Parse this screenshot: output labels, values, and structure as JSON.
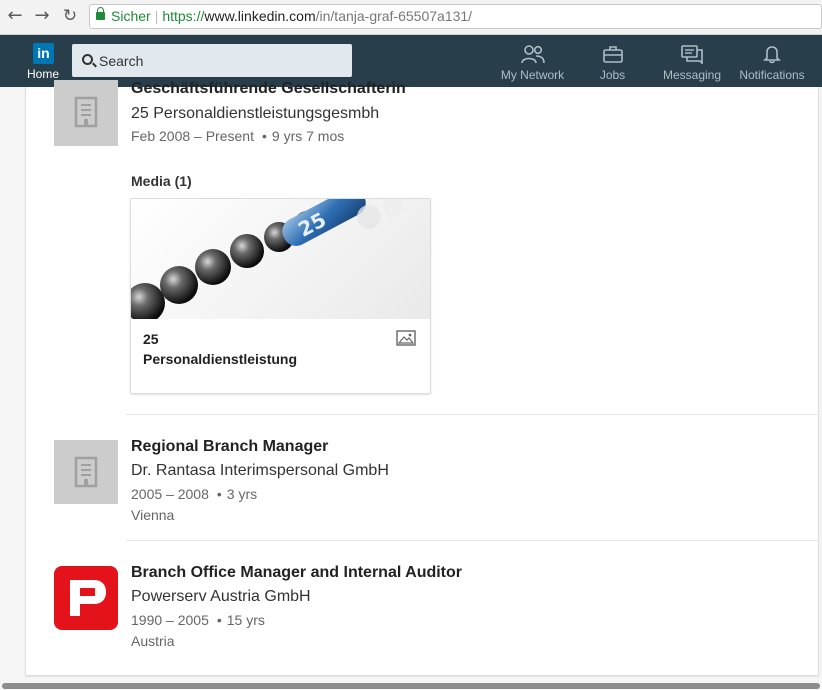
{
  "browser": {
    "secure_label": "Sicher",
    "url_scheme": "https://",
    "url_host": "www.linkedin.com",
    "url_path": "/in/tanja-graf-65507a131/"
  },
  "nav": {
    "logo_text": "in",
    "home_label": "Home",
    "search_placeholder": "Search",
    "items": [
      {
        "label": "My Network",
        "icon": "people-icon"
      },
      {
        "label": "Jobs",
        "icon": "briefcase-icon"
      },
      {
        "label": "Messaging",
        "icon": "messaging-icon"
      },
      {
        "label": "Notifications",
        "icon": "bell-icon"
      }
    ]
  },
  "experience": [
    {
      "title": "Geschäftsführende Gesellschafterin",
      "company": "25 Personaldienstleistungsgesmbh",
      "dates": "Feb 2008 – Present",
      "duration": "9 yrs 7 mos",
      "logo": "building-icon",
      "media_header": "Media (1)",
      "media_title_line1": "25",
      "media_title_line2": "Personaldienstleistung"
    },
    {
      "title": "Regional Branch Manager",
      "company": "Dr. Rantasa Interimspersonal GmbH",
      "dates": "2005 – 2008",
      "duration": "3 yrs",
      "location": "Vienna",
      "logo": "building-icon"
    },
    {
      "title": "Branch Office Manager and Internal Auditor",
      "company": "Powerserv Austria GmbH",
      "dates": "1990 – 2005",
      "duration": "15 yrs",
      "location": "Austria",
      "logo": "powerserv-logo"
    }
  ],
  "colors": {
    "nav_bg": "#283e4a",
    "linkedin_blue": "#0077b5",
    "powerserv_red": "#e3121b",
    "secure_green": "#1f8a3a"
  }
}
